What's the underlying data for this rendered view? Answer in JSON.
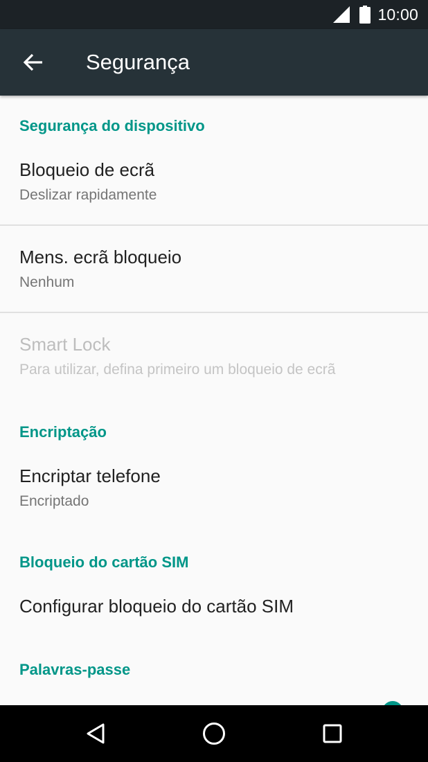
{
  "status_bar": {
    "time": "10:00",
    "icons": [
      "cell-signal-icon",
      "battery-icon"
    ]
  },
  "app_bar": {
    "back_icon": "arrow-back-icon",
    "title": "Segurança"
  },
  "sections": [
    {
      "header": "Segurança do dispositivo",
      "items": [
        {
          "title": "Bloqueio de ecrã",
          "summary": "Deslizar rapidamente",
          "enabled": true
        },
        {
          "title": "Mens. ecrã bloqueio",
          "summary": "Nenhum",
          "enabled": true
        },
        {
          "title": "Smart Lock",
          "summary": "Para utilizar, defina primeiro um bloqueio de ecrã",
          "enabled": false
        }
      ]
    },
    {
      "header": "Encriptação",
      "items": [
        {
          "title": "Encriptar telefone",
          "summary": "Encriptado",
          "enabled": true
        }
      ]
    },
    {
      "header": "Bloqueio do cartão SIM",
      "items": [
        {
          "title": "Configurar bloqueio do cartão SIM",
          "enabled": true
        }
      ]
    },
    {
      "header": "Palavras-passe",
      "items": []
    }
  ],
  "nav_bar": {
    "buttons": [
      "back-triangle-icon",
      "home-circle-icon",
      "recents-square-icon"
    ]
  },
  "colors": {
    "status_bar": "#1c2226",
    "app_bar": "#263238",
    "accent": "#009688",
    "background": "#fafafa",
    "divider": "#e0e0e0"
  }
}
